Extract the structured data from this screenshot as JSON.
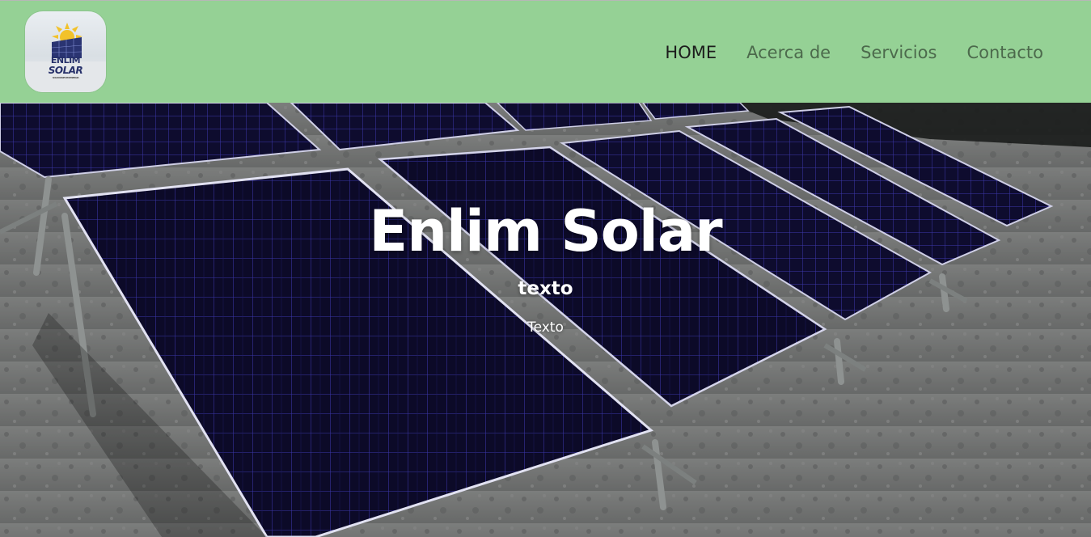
{
  "header": {
    "logo": {
      "line1": "ENLIM",
      "line2": "SOLAR",
      "line3": "SOLUCIONES EN ENERGIA"
    },
    "nav": [
      {
        "label": "HOME",
        "active": true
      },
      {
        "label": "Acerca de",
        "active": false
      },
      {
        "label": "Servicios",
        "active": false
      },
      {
        "label": "Contacto",
        "active": false
      }
    ]
  },
  "hero": {
    "title": "Enlim Solar",
    "subtitle": "texto",
    "body": "Texto",
    "background": "solar-panels-photo"
  },
  "colors": {
    "header_bg": "#95d195",
    "nav_active": "#1c1c1c",
    "nav_inactive": "#4c6a4c",
    "panel_color": "#0d0b2a",
    "hero_text": "#ffffff"
  }
}
